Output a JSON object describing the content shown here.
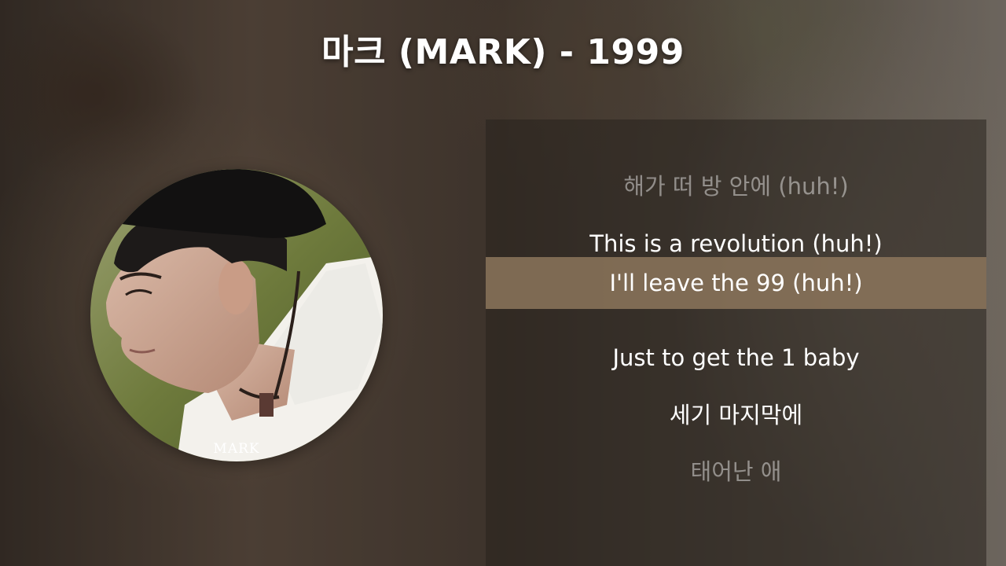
{
  "header": {
    "title": "마크 (MARK) - 1999"
  },
  "album": {
    "cover_label": "MARK",
    "image": "album-cover-portrait"
  },
  "lyrics": {
    "lines": [
      {
        "text": "해가 떠 방 안에 (huh!)",
        "state": "dim"
      },
      {
        "text": "This is a revolution (huh!)",
        "state": "normal"
      },
      {
        "text": "I'll leave the 99 (huh!)",
        "state": "active"
      },
      {
        "text": "Just to get the 1 baby",
        "state": "normal"
      },
      {
        "text": "세기 마지막에",
        "state": "normal"
      },
      {
        "text": "태어난 애",
        "state": "dim"
      }
    ]
  },
  "colors": {
    "highlight": "#8c765c",
    "text": "#ffffff"
  }
}
